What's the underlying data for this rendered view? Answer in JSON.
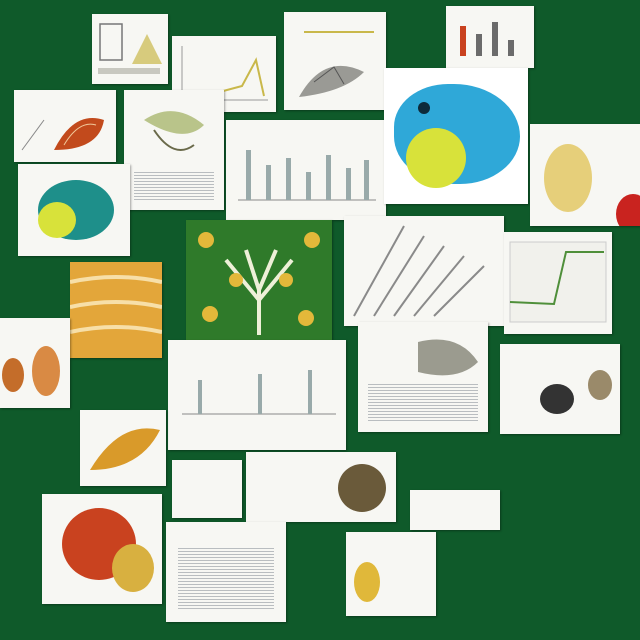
{
  "scene": {
    "background": "#0f5a2a",
    "accent_colors": [
      "#2fa8d8",
      "#d8e23a",
      "#e3a63a",
      "#c9421f",
      "#f1d27a",
      "#4f8f3a"
    ]
  },
  "cards": [
    {
      "name": "card-flask-drawing",
      "kind": "illustration"
    },
    {
      "name": "card-line-plot-top",
      "kind": "chart"
    },
    {
      "name": "card-grayscale-sketch-top",
      "kind": "illustration"
    },
    {
      "name": "card-bar-chart-small",
      "kind": "chart"
    },
    {
      "name": "card-shell-orange",
      "kind": "illustration"
    },
    {
      "name": "card-fossil-beige",
      "kind": "illustration"
    },
    {
      "name": "card-bar-chart-wide",
      "kind": "chart"
    },
    {
      "name": "card-blue-fish",
      "kind": "illustration"
    },
    {
      "name": "card-teal-egg",
      "kind": "illustration"
    },
    {
      "name": "card-egg-yellow-right",
      "kind": "illustration"
    },
    {
      "name": "card-orange-texture",
      "kind": "illustration"
    },
    {
      "name": "card-green-tree",
      "kind": "illustration"
    },
    {
      "name": "card-striped-engraving",
      "kind": "illustration"
    },
    {
      "name": "card-line-graph-right",
      "kind": "chart"
    },
    {
      "name": "card-pots-left",
      "kind": "illustration"
    },
    {
      "name": "card-bar-chart-center",
      "kind": "chart"
    },
    {
      "name": "card-engraving-creature",
      "kind": "illustration"
    },
    {
      "name": "card-leaf-orange",
      "kind": "illustration"
    },
    {
      "name": "card-small-chart",
      "kind": "chart"
    },
    {
      "name": "card-photo-strip",
      "kind": "illustration"
    },
    {
      "name": "card-red-seed",
      "kind": "illustration"
    },
    {
      "name": "card-text-book",
      "kind": "document"
    },
    {
      "name": "card-small-bars-bottom",
      "kind": "chart"
    },
    {
      "name": "card-gold-lemon",
      "kind": "illustration"
    },
    {
      "name": "card-dark-beetle",
      "kind": "illustration"
    }
  ]
}
